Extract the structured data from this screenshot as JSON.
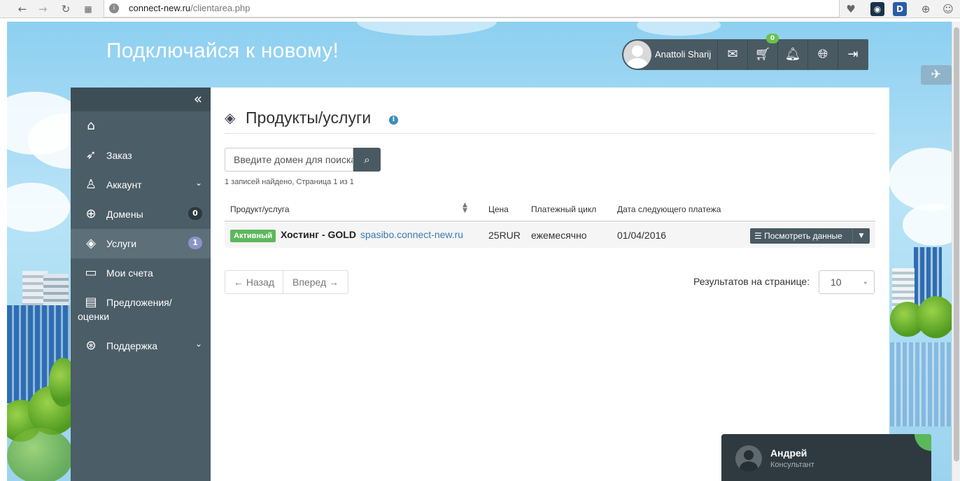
{
  "browser": {
    "url_host": "connect-new.ru",
    "url_path": "/clientarea.php"
  },
  "header": {
    "site_title": "Подключайся к новому!",
    "user_name": "Anattoli Sharij",
    "cart_count": "0"
  },
  "sidebar": {
    "collapse_icon": "«",
    "items": [
      {
        "label": "",
        "icon": "home-icon"
      },
      {
        "label": "Заказ",
        "icon": "rocket-icon"
      },
      {
        "label": "Аккаунт",
        "icon": "user-icon"
      },
      {
        "label": "Домены",
        "icon": "globe-icon",
        "badge": "0"
      },
      {
        "label": "Услуги",
        "icon": "layers-icon",
        "badge": "1"
      },
      {
        "label": "Мои счета",
        "icon": "inbox-icon"
      },
      {
        "label": "Предложения/",
        "label2": "оценки",
        "icon": "calculator-icon"
      },
      {
        "label": "Поддержка",
        "icon": "lifebuoy-icon"
      }
    ]
  },
  "main": {
    "title": "Продукты/услуги",
    "search_placeholder": "Введите домен для поиска",
    "records_text": "1 записей найдено, Страница 1 из 1",
    "table": {
      "headers": [
        "Продукт/услуга",
        "Цена",
        "Платежный цикл",
        "Дата следующего платежа"
      ],
      "rows": [
        {
          "status": "Активный",
          "product": "Хостинг - GOLD",
          "domain": "spasibo.connect-new.ru",
          "price": "25RUR",
          "cycle": "ежемесячно",
          "next_date": "01/04/2016",
          "action": "Посмотреть данные"
        }
      ]
    },
    "pager": {
      "prev": "← Назад",
      "next": "Вперед →"
    },
    "per_page_label": "Результатов на странице:",
    "per_page_value": "10"
  },
  "chat": {
    "name": "Андрей",
    "role": "Консультант"
  },
  "colors": {
    "sidebar_bg": "#4b5d66",
    "accent_dark": "#4a5a63",
    "status_active": "#5cb85c",
    "link": "#3c7ab5"
  }
}
